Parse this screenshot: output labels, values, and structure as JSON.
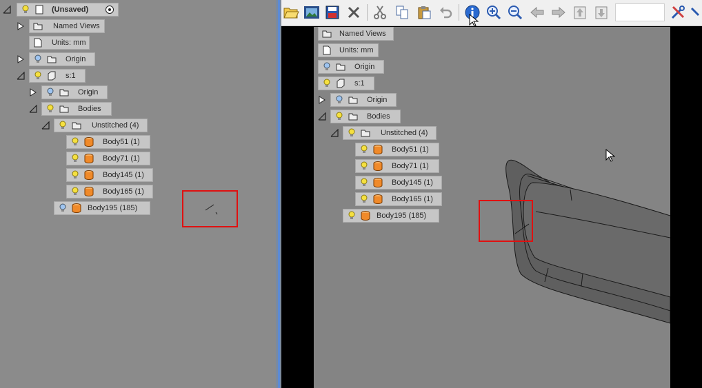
{
  "tree": {
    "root_label": "(Unsaved)",
    "named_views": "Named Views",
    "units": "Units: mm",
    "origin": "Origin",
    "part": "s:1",
    "part_origin": "Origin",
    "bodies": "Bodies",
    "unstitched": "Unstitched (4)",
    "body_items": [
      "Body51 (1)",
      "Body71 (1)",
      "Body145 (1)",
      "Body165 (1)"
    ],
    "body195": "Body195 (185)"
  },
  "overlay_tree": {
    "named_views": "Named Views",
    "units": "Units: mm",
    "origin": "Origin",
    "part": "s:1",
    "part_origin": "Origin",
    "bodies": "Bodies",
    "unstitched": "Unstitched (4)",
    "body_items": [
      "Body51 (1)",
      "Body71 (1)",
      "Body145 (1)",
      "Body165 (1)"
    ],
    "body195": "Body195 (185)"
  },
  "toolbar": {
    "icons": [
      "open-folder-icon",
      "image-icon",
      "save-icon",
      "delete-icon",
      "cut-icon",
      "copy-icon",
      "paste-icon",
      "undo-icon",
      "info-icon",
      "zoom-in-icon",
      "zoom-out-icon",
      "back-arrow-icon",
      "forward-arrow-icon",
      "move-up-icon",
      "move-down-icon",
      "tools-icon"
    ]
  },
  "colors": {
    "highlight": "#e01010",
    "panel_bg": "#8b8b8b",
    "node_bg": "#c6c6c6",
    "body_icon": "#f08a2a",
    "bulb_on": "#f5e040",
    "bulb_off": "#9ec4f0"
  }
}
